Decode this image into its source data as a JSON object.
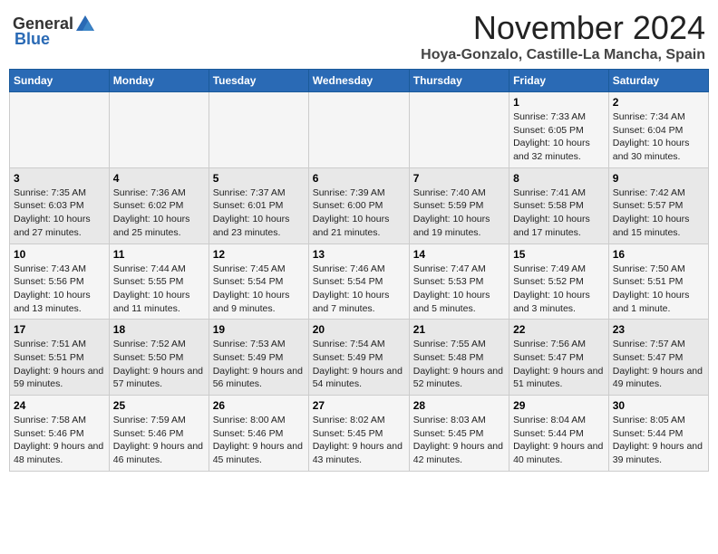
{
  "header": {
    "logo_general": "General",
    "logo_blue": "Blue",
    "month_title": "November 2024",
    "location": "Hoya-Gonzalo, Castille-La Mancha, Spain"
  },
  "weekdays": [
    "Sunday",
    "Monday",
    "Tuesday",
    "Wednesday",
    "Thursday",
    "Friday",
    "Saturday"
  ],
  "weeks": [
    [
      {
        "day": "",
        "sunrise": "",
        "sunset": "",
        "daylight": ""
      },
      {
        "day": "",
        "sunrise": "",
        "sunset": "",
        "daylight": ""
      },
      {
        "day": "",
        "sunrise": "",
        "sunset": "",
        "daylight": ""
      },
      {
        "day": "",
        "sunrise": "",
        "sunset": "",
        "daylight": ""
      },
      {
        "day": "",
        "sunrise": "",
        "sunset": "",
        "daylight": ""
      },
      {
        "day": "1",
        "sunrise": "Sunrise: 7:33 AM",
        "sunset": "Sunset: 6:05 PM",
        "daylight": "Daylight: 10 hours and 32 minutes."
      },
      {
        "day": "2",
        "sunrise": "Sunrise: 7:34 AM",
        "sunset": "Sunset: 6:04 PM",
        "daylight": "Daylight: 10 hours and 30 minutes."
      }
    ],
    [
      {
        "day": "3",
        "sunrise": "Sunrise: 7:35 AM",
        "sunset": "Sunset: 6:03 PM",
        "daylight": "Daylight: 10 hours and 27 minutes."
      },
      {
        "day": "4",
        "sunrise": "Sunrise: 7:36 AM",
        "sunset": "Sunset: 6:02 PM",
        "daylight": "Daylight: 10 hours and 25 minutes."
      },
      {
        "day": "5",
        "sunrise": "Sunrise: 7:37 AM",
        "sunset": "Sunset: 6:01 PM",
        "daylight": "Daylight: 10 hours and 23 minutes."
      },
      {
        "day": "6",
        "sunrise": "Sunrise: 7:39 AM",
        "sunset": "Sunset: 6:00 PM",
        "daylight": "Daylight: 10 hours and 21 minutes."
      },
      {
        "day": "7",
        "sunrise": "Sunrise: 7:40 AM",
        "sunset": "Sunset: 5:59 PM",
        "daylight": "Daylight: 10 hours and 19 minutes."
      },
      {
        "day": "8",
        "sunrise": "Sunrise: 7:41 AM",
        "sunset": "Sunset: 5:58 PM",
        "daylight": "Daylight: 10 hours and 17 minutes."
      },
      {
        "day": "9",
        "sunrise": "Sunrise: 7:42 AM",
        "sunset": "Sunset: 5:57 PM",
        "daylight": "Daylight: 10 hours and 15 minutes."
      }
    ],
    [
      {
        "day": "10",
        "sunrise": "Sunrise: 7:43 AM",
        "sunset": "Sunset: 5:56 PM",
        "daylight": "Daylight: 10 hours and 13 minutes."
      },
      {
        "day": "11",
        "sunrise": "Sunrise: 7:44 AM",
        "sunset": "Sunset: 5:55 PM",
        "daylight": "Daylight: 10 hours and 11 minutes."
      },
      {
        "day": "12",
        "sunrise": "Sunrise: 7:45 AM",
        "sunset": "Sunset: 5:54 PM",
        "daylight": "Daylight: 10 hours and 9 minutes."
      },
      {
        "day": "13",
        "sunrise": "Sunrise: 7:46 AM",
        "sunset": "Sunset: 5:54 PM",
        "daylight": "Daylight: 10 hours and 7 minutes."
      },
      {
        "day": "14",
        "sunrise": "Sunrise: 7:47 AM",
        "sunset": "Sunset: 5:53 PM",
        "daylight": "Daylight: 10 hours and 5 minutes."
      },
      {
        "day": "15",
        "sunrise": "Sunrise: 7:49 AM",
        "sunset": "Sunset: 5:52 PM",
        "daylight": "Daylight: 10 hours and 3 minutes."
      },
      {
        "day": "16",
        "sunrise": "Sunrise: 7:50 AM",
        "sunset": "Sunset: 5:51 PM",
        "daylight": "Daylight: 10 hours and 1 minute."
      }
    ],
    [
      {
        "day": "17",
        "sunrise": "Sunrise: 7:51 AM",
        "sunset": "Sunset: 5:51 PM",
        "daylight": "Daylight: 9 hours and 59 minutes."
      },
      {
        "day": "18",
        "sunrise": "Sunrise: 7:52 AM",
        "sunset": "Sunset: 5:50 PM",
        "daylight": "Daylight: 9 hours and 57 minutes."
      },
      {
        "day": "19",
        "sunrise": "Sunrise: 7:53 AM",
        "sunset": "Sunset: 5:49 PM",
        "daylight": "Daylight: 9 hours and 56 minutes."
      },
      {
        "day": "20",
        "sunrise": "Sunrise: 7:54 AM",
        "sunset": "Sunset: 5:49 PM",
        "daylight": "Daylight: 9 hours and 54 minutes."
      },
      {
        "day": "21",
        "sunrise": "Sunrise: 7:55 AM",
        "sunset": "Sunset: 5:48 PM",
        "daylight": "Daylight: 9 hours and 52 minutes."
      },
      {
        "day": "22",
        "sunrise": "Sunrise: 7:56 AM",
        "sunset": "Sunset: 5:47 PM",
        "daylight": "Daylight: 9 hours and 51 minutes."
      },
      {
        "day": "23",
        "sunrise": "Sunrise: 7:57 AM",
        "sunset": "Sunset: 5:47 PM",
        "daylight": "Daylight: 9 hours and 49 minutes."
      }
    ],
    [
      {
        "day": "24",
        "sunrise": "Sunrise: 7:58 AM",
        "sunset": "Sunset: 5:46 PM",
        "daylight": "Daylight: 9 hours and 48 minutes."
      },
      {
        "day": "25",
        "sunrise": "Sunrise: 7:59 AM",
        "sunset": "Sunset: 5:46 PM",
        "daylight": "Daylight: 9 hours and 46 minutes."
      },
      {
        "day": "26",
        "sunrise": "Sunrise: 8:00 AM",
        "sunset": "Sunset: 5:46 PM",
        "daylight": "Daylight: 9 hours and 45 minutes."
      },
      {
        "day": "27",
        "sunrise": "Sunrise: 8:02 AM",
        "sunset": "Sunset: 5:45 PM",
        "daylight": "Daylight: 9 hours and 43 minutes."
      },
      {
        "day": "28",
        "sunrise": "Sunrise: 8:03 AM",
        "sunset": "Sunset: 5:45 PM",
        "daylight": "Daylight: 9 hours and 42 minutes."
      },
      {
        "day": "29",
        "sunrise": "Sunrise: 8:04 AM",
        "sunset": "Sunset: 5:44 PM",
        "daylight": "Daylight: 9 hours and 40 minutes."
      },
      {
        "day": "30",
        "sunrise": "Sunrise: 8:05 AM",
        "sunset": "Sunset: 5:44 PM",
        "daylight": "Daylight: 9 hours and 39 minutes."
      }
    ]
  ]
}
